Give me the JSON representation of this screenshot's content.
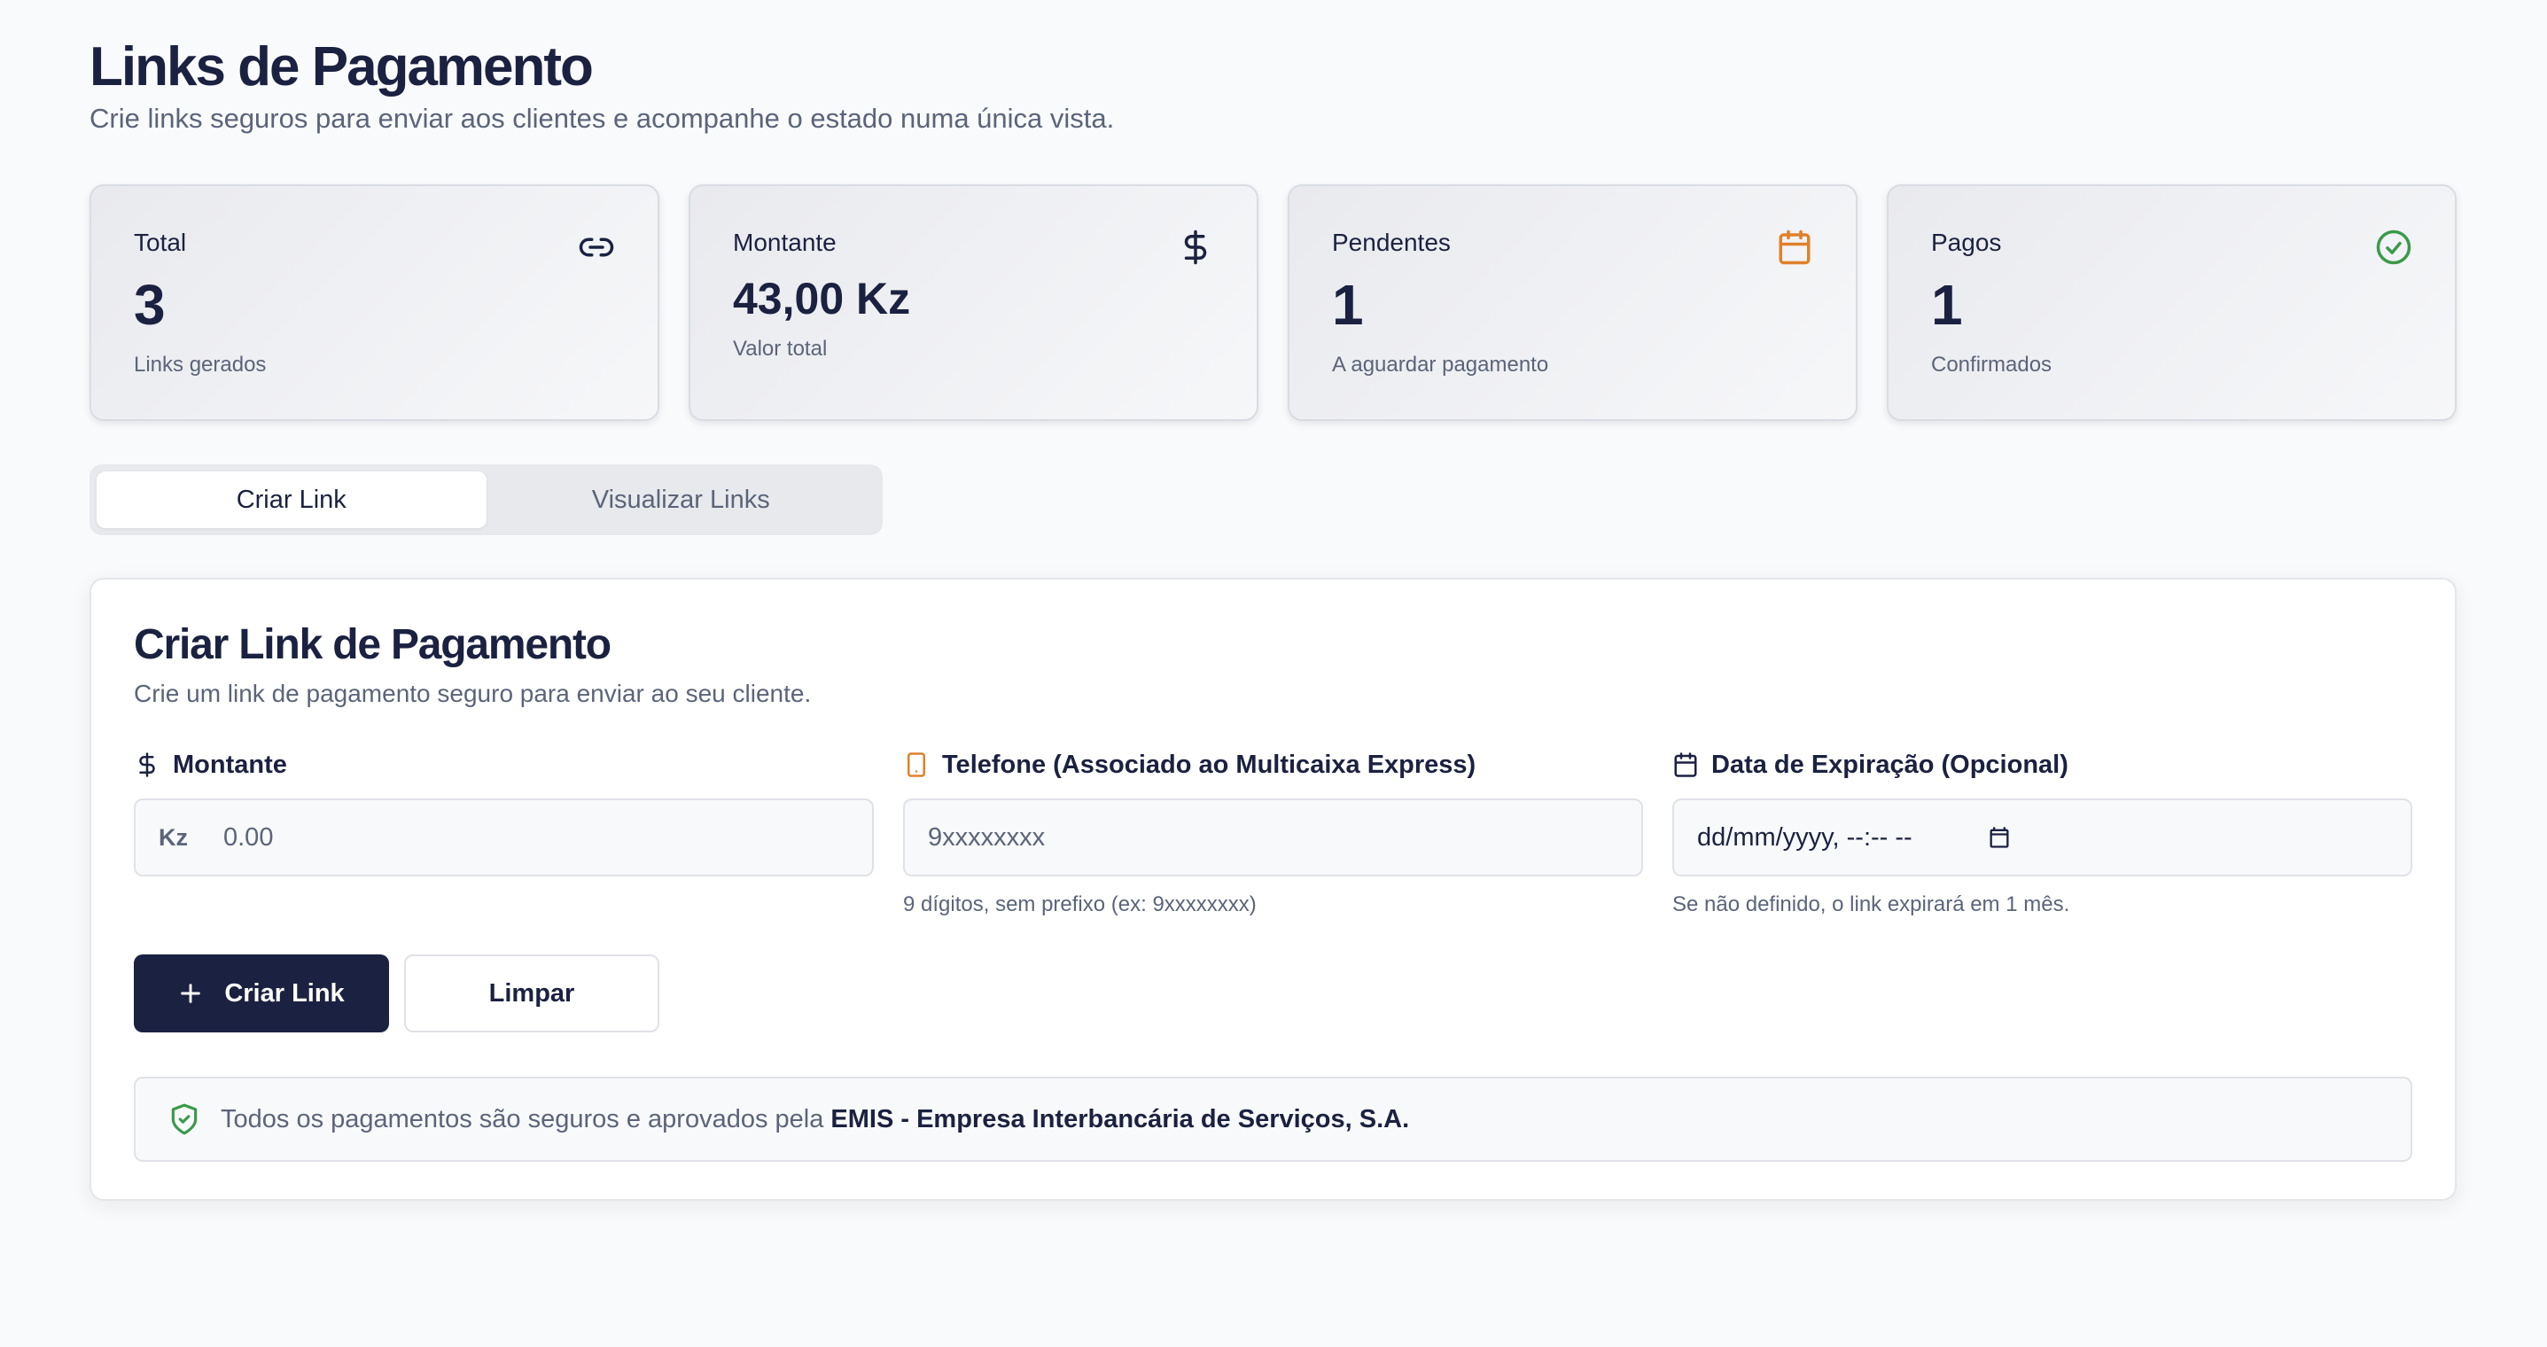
{
  "header": {
    "title": "Links de Pagamento",
    "subtitle": "Crie links seguros para enviar aos clientes e acompanhe o estado numa única vista."
  },
  "stats": [
    {
      "label": "Total",
      "value": "3",
      "note": "Links gerados",
      "icon": "link-icon"
    },
    {
      "label": "Montante",
      "value": "43,00 Kz",
      "note": "Valor total",
      "icon": "dollar-icon"
    },
    {
      "label": "Pendentes",
      "value": "1",
      "note": "A aguardar pagamento",
      "icon": "calendar-icon",
      "icon_color": "#e0802a"
    },
    {
      "label": "Pagos",
      "value": "1",
      "note": "Confirmados",
      "icon": "check-circle-icon",
      "icon_color": "#3a9a4a"
    }
  ],
  "tabs": [
    {
      "label": "Criar Link",
      "active": true
    },
    {
      "label": "Visualizar Links",
      "active": false
    }
  ],
  "form": {
    "title": "Criar Link de Pagamento",
    "description": "Crie um link de pagamento seguro para enviar ao seu cliente.",
    "amount": {
      "label": "Montante",
      "prefix": "Kz",
      "placeholder": "0.00"
    },
    "phone": {
      "label": "Telefone (Associado ao Multicaixa Express)",
      "placeholder": "9xxxxxxxx",
      "hint": "9 dígitos, sem prefixo (ex: 9xxxxxxxx)"
    },
    "expiry": {
      "label": "Data de Expiração (Opcional)",
      "value": "dd/mm/yyyy, --:-- --",
      "hint": "Se não definido, o link expirará em 1 mês."
    },
    "create_button": "Criar Link",
    "clear_button": "Limpar",
    "notice_text": "Todos os pagamentos são seguros e aprovados pela",
    "notice_strong": "EMIS - Empresa Interbancária de Serviços, S.A."
  },
  "colors": {
    "primary": "#1b2140",
    "warning": "#e0802a",
    "success": "#3a9a4a"
  }
}
